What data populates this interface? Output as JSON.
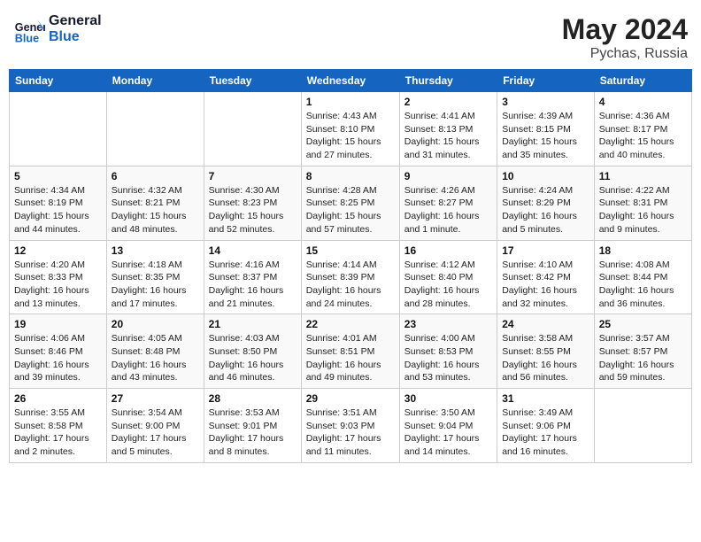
{
  "header": {
    "logo_line1": "General",
    "logo_line2": "Blue",
    "month": "May 2024",
    "location": "Pychas, Russia"
  },
  "days_of_week": [
    "Sunday",
    "Monday",
    "Tuesday",
    "Wednesday",
    "Thursday",
    "Friday",
    "Saturday"
  ],
  "weeks": [
    [
      {
        "day": "",
        "info": ""
      },
      {
        "day": "",
        "info": ""
      },
      {
        "day": "",
        "info": ""
      },
      {
        "day": "1",
        "info": "Sunrise: 4:43 AM\nSunset: 8:10 PM\nDaylight: 15 hours\nand 27 minutes."
      },
      {
        "day": "2",
        "info": "Sunrise: 4:41 AM\nSunset: 8:13 PM\nDaylight: 15 hours\nand 31 minutes."
      },
      {
        "day": "3",
        "info": "Sunrise: 4:39 AM\nSunset: 8:15 PM\nDaylight: 15 hours\nand 35 minutes."
      },
      {
        "day": "4",
        "info": "Sunrise: 4:36 AM\nSunset: 8:17 PM\nDaylight: 15 hours\nand 40 minutes."
      }
    ],
    [
      {
        "day": "5",
        "info": "Sunrise: 4:34 AM\nSunset: 8:19 PM\nDaylight: 15 hours\nand 44 minutes."
      },
      {
        "day": "6",
        "info": "Sunrise: 4:32 AM\nSunset: 8:21 PM\nDaylight: 15 hours\nand 48 minutes."
      },
      {
        "day": "7",
        "info": "Sunrise: 4:30 AM\nSunset: 8:23 PM\nDaylight: 15 hours\nand 52 minutes."
      },
      {
        "day": "8",
        "info": "Sunrise: 4:28 AM\nSunset: 8:25 PM\nDaylight: 15 hours\nand 57 minutes."
      },
      {
        "day": "9",
        "info": "Sunrise: 4:26 AM\nSunset: 8:27 PM\nDaylight: 16 hours\nand 1 minute."
      },
      {
        "day": "10",
        "info": "Sunrise: 4:24 AM\nSunset: 8:29 PM\nDaylight: 16 hours\nand 5 minutes."
      },
      {
        "day": "11",
        "info": "Sunrise: 4:22 AM\nSunset: 8:31 PM\nDaylight: 16 hours\nand 9 minutes."
      }
    ],
    [
      {
        "day": "12",
        "info": "Sunrise: 4:20 AM\nSunset: 8:33 PM\nDaylight: 16 hours\nand 13 minutes."
      },
      {
        "day": "13",
        "info": "Sunrise: 4:18 AM\nSunset: 8:35 PM\nDaylight: 16 hours\nand 17 minutes."
      },
      {
        "day": "14",
        "info": "Sunrise: 4:16 AM\nSunset: 8:37 PM\nDaylight: 16 hours\nand 21 minutes."
      },
      {
        "day": "15",
        "info": "Sunrise: 4:14 AM\nSunset: 8:39 PM\nDaylight: 16 hours\nand 24 minutes."
      },
      {
        "day": "16",
        "info": "Sunrise: 4:12 AM\nSunset: 8:40 PM\nDaylight: 16 hours\nand 28 minutes."
      },
      {
        "day": "17",
        "info": "Sunrise: 4:10 AM\nSunset: 8:42 PM\nDaylight: 16 hours\nand 32 minutes."
      },
      {
        "day": "18",
        "info": "Sunrise: 4:08 AM\nSunset: 8:44 PM\nDaylight: 16 hours\nand 36 minutes."
      }
    ],
    [
      {
        "day": "19",
        "info": "Sunrise: 4:06 AM\nSunset: 8:46 PM\nDaylight: 16 hours\nand 39 minutes."
      },
      {
        "day": "20",
        "info": "Sunrise: 4:05 AM\nSunset: 8:48 PM\nDaylight: 16 hours\nand 43 minutes."
      },
      {
        "day": "21",
        "info": "Sunrise: 4:03 AM\nSunset: 8:50 PM\nDaylight: 16 hours\nand 46 minutes."
      },
      {
        "day": "22",
        "info": "Sunrise: 4:01 AM\nSunset: 8:51 PM\nDaylight: 16 hours\nand 49 minutes."
      },
      {
        "day": "23",
        "info": "Sunrise: 4:00 AM\nSunset: 8:53 PM\nDaylight: 16 hours\nand 53 minutes."
      },
      {
        "day": "24",
        "info": "Sunrise: 3:58 AM\nSunset: 8:55 PM\nDaylight: 16 hours\nand 56 minutes."
      },
      {
        "day": "25",
        "info": "Sunrise: 3:57 AM\nSunset: 8:57 PM\nDaylight: 16 hours\nand 59 minutes."
      }
    ],
    [
      {
        "day": "26",
        "info": "Sunrise: 3:55 AM\nSunset: 8:58 PM\nDaylight: 17 hours\nand 2 minutes."
      },
      {
        "day": "27",
        "info": "Sunrise: 3:54 AM\nSunset: 9:00 PM\nDaylight: 17 hours\nand 5 minutes."
      },
      {
        "day": "28",
        "info": "Sunrise: 3:53 AM\nSunset: 9:01 PM\nDaylight: 17 hours\nand 8 minutes."
      },
      {
        "day": "29",
        "info": "Sunrise: 3:51 AM\nSunset: 9:03 PM\nDaylight: 17 hours\nand 11 minutes."
      },
      {
        "day": "30",
        "info": "Sunrise: 3:50 AM\nSunset: 9:04 PM\nDaylight: 17 hours\nand 14 minutes."
      },
      {
        "day": "31",
        "info": "Sunrise: 3:49 AM\nSunset: 9:06 PM\nDaylight: 17 hours\nand 16 minutes."
      },
      {
        "day": "",
        "info": ""
      }
    ]
  ]
}
